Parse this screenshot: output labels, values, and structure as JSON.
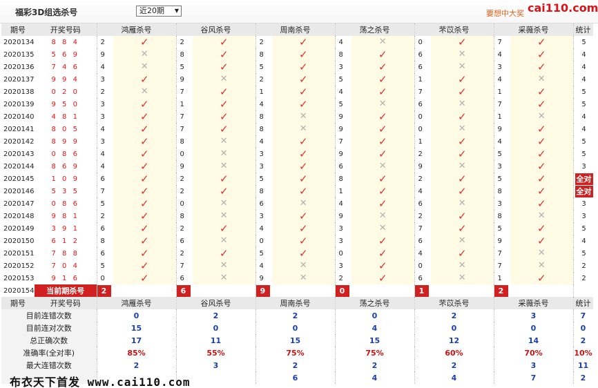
{
  "header": {
    "title": "福彩3D组选杀号",
    "period_select": "近20期",
    "ad_text": "要想中大奖",
    "logo": "cai110.com"
  },
  "columns": {
    "period": "期号",
    "draw": "开奖号码",
    "experts": [
      "鸿雁杀号",
      "谷风杀号",
      "周南杀号",
      "荡之杀号",
      "芣苡杀号",
      "采薇杀号"
    ],
    "stats": "统计"
  },
  "rows": [
    {
      "period": "2020134",
      "draw": "8 8 4",
      "kills": [
        [
          "2",
          "ok"
        ],
        [
          "2",
          "ok"
        ],
        [
          "2",
          "ok"
        ],
        [
          "4",
          "no"
        ],
        [
          "0",
          "ok"
        ],
        [
          "7",
          "ok"
        ]
      ],
      "count": "5"
    },
    {
      "period": "2020135",
      "draw": "5 6 9",
      "kills": [
        [
          "9",
          "no"
        ],
        [
          "8",
          "ok"
        ],
        [
          "8",
          "ok"
        ],
        [
          "8",
          "ok"
        ],
        [
          "6",
          "no"
        ],
        [
          "4",
          "ok"
        ]
      ],
      "count": "4"
    },
    {
      "period": "2020136",
      "draw": "7 4 6",
      "kills": [
        [
          "4",
          "no"
        ],
        [
          "5",
          "ok"
        ],
        [
          "5",
          "ok"
        ],
        [
          "3",
          "ok"
        ],
        [
          "6",
          "no"
        ],
        [
          "3",
          "ok"
        ]
      ],
      "count": "4"
    },
    {
      "period": "2020137",
      "draw": "9 9 4",
      "kills": [
        [
          "3",
          "ok"
        ],
        [
          "9",
          "no"
        ],
        [
          "2",
          "ok"
        ],
        [
          "5",
          "ok"
        ],
        [
          "1",
          "ok"
        ],
        [
          "4",
          "no"
        ]
      ],
      "count": "4"
    },
    {
      "period": "2020138",
      "draw": "0 2 0",
      "kills": [
        [
          "2",
          "no"
        ],
        [
          "7",
          "ok"
        ],
        [
          "1",
          "ok"
        ],
        [
          "4",
          "ok"
        ],
        [
          "7",
          "ok"
        ],
        [
          "1",
          "ok"
        ]
      ],
      "count": "5"
    },
    {
      "period": "2020139",
      "draw": "9 5 0",
      "kills": [
        [
          "3",
          "ok"
        ],
        [
          "1",
          "ok"
        ],
        [
          "4",
          "ok"
        ],
        [
          "5",
          "no"
        ],
        [
          "6",
          "no"
        ],
        [
          "7",
          "ok"
        ]
      ],
      "count": "5"
    },
    {
      "period": "2020140",
      "draw": "4 8 1",
      "kills": [
        [
          "3",
          "ok"
        ],
        [
          "7",
          "ok"
        ],
        [
          "8",
          "no"
        ],
        [
          "9",
          "ok"
        ],
        [
          "0",
          "ok"
        ],
        [
          "1",
          "no"
        ]
      ],
      "count": "4"
    },
    {
      "period": "2020141",
      "draw": "8 0 5",
      "kills": [
        [
          "4",
          "ok"
        ],
        [
          "7",
          "ok"
        ],
        [
          "8",
          "no"
        ],
        [
          "9",
          "ok"
        ],
        [
          "0",
          "no"
        ],
        [
          "9",
          "ok"
        ]
      ],
      "count": "4"
    },
    {
      "period": "2020142",
      "draw": "8 9 9",
      "kills": [
        [
          "3",
          "ok"
        ],
        [
          "8",
          "no"
        ],
        [
          "4",
          "ok"
        ],
        [
          "7",
          "ok"
        ],
        [
          "1",
          "ok"
        ],
        [
          "4",
          "ok"
        ]
      ],
      "count": "5"
    },
    {
      "period": "2020143",
      "draw": "0 8 6",
      "kills": [
        [
          "4",
          "ok"
        ],
        [
          "0",
          "no"
        ],
        [
          "3",
          "ok"
        ],
        [
          "9",
          "ok"
        ],
        [
          "2",
          "ok"
        ],
        [
          "5",
          "ok"
        ]
      ],
      "count": "5"
    },
    {
      "period": "2020144",
      "draw": "8 6 9",
      "kills": [
        [
          "4",
          "ok"
        ],
        [
          "9",
          "no"
        ],
        [
          "3",
          "ok"
        ],
        [
          "6",
          "no"
        ],
        [
          "9",
          "no"
        ],
        [
          "3",
          "ok"
        ]
      ],
      "count": "3"
    },
    {
      "period": "2020145",
      "draw": "1 0 9",
      "kills": [
        [
          "6",
          "ok"
        ],
        [
          "2",
          "ok"
        ],
        [
          "5",
          "ok"
        ],
        [
          "8",
          "ok"
        ],
        [
          "2",
          "ok"
        ],
        [
          "5",
          "ok"
        ]
      ],
      "count": "全对"
    },
    {
      "period": "2020146",
      "draw": "5 3 5",
      "kills": [
        [
          "7",
          "ok"
        ],
        [
          "2",
          "ok"
        ],
        [
          "8",
          "ok"
        ],
        [
          "1",
          "ok"
        ],
        [
          "4",
          "ok"
        ],
        [
          "8",
          "ok"
        ]
      ],
      "count": "全对"
    },
    {
      "period": "2020147",
      "draw": "0 8 6",
      "kills": [
        [
          "5",
          "ok"
        ],
        [
          "0",
          "no"
        ],
        [
          "6",
          "no"
        ],
        [
          "4",
          "ok"
        ],
        [
          "6",
          "no"
        ],
        [
          "3",
          "ok"
        ]
      ],
      "count": "3"
    },
    {
      "period": "2020148",
      "draw": "9 8 1",
      "kills": [
        [
          "2",
          "ok"
        ],
        [
          "8",
          "no"
        ],
        [
          "3",
          "ok"
        ],
        [
          "9",
          "no"
        ],
        [
          "2",
          "ok"
        ],
        [
          "8",
          "no"
        ]
      ],
      "count": "3"
    },
    {
      "period": "2020149",
      "draw": "3 9 1",
      "kills": [
        [
          "6",
          "ok"
        ],
        [
          "2",
          "ok"
        ],
        [
          "4",
          "ok"
        ],
        [
          "3",
          "no"
        ],
        [
          "7",
          "ok"
        ],
        [
          "5",
          "ok"
        ]
      ],
      "count": "5"
    },
    {
      "period": "2020150",
      "draw": "6 1 2",
      "kills": [
        [
          "8",
          "ok"
        ],
        [
          "6",
          "no"
        ],
        [
          "0",
          "ok"
        ],
        [
          "3",
          "ok"
        ],
        [
          "6",
          "no"
        ],
        [
          "9",
          "ok"
        ]
      ],
      "count": "4"
    },
    {
      "period": "2020151",
      "draw": "7 8 8",
      "kills": [
        [
          "6",
          "ok"
        ],
        [
          "2",
          "ok"
        ],
        [
          "5",
          "ok"
        ],
        [
          "0",
          "ok"
        ],
        [
          "4",
          "ok"
        ],
        [
          "7",
          "no"
        ]
      ],
      "count": "5"
    },
    {
      "period": "2020152",
      "draw": "7 0 4",
      "kills": [
        [
          "5",
          "ok"
        ],
        [
          "7",
          "no"
        ],
        [
          "4",
          "no"
        ],
        [
          "3",
          "ok"
        ],
        [
          "0",
          "no"
        ],
        [
          "7",
          "no"
        ]
      ],
      "count": "2"
    },
    {
      "period": "2020153",
      "draw": "9 1 6",
      "kills": [
        [
          "0",
          "ok"
        ],
        [
          "6",
          "no"
        ],
        [
          "9",
          "no"
        ],
        [
          "2",
          "ok"
        ],
        [
          "6",
          "no"
        ],
        [
          "1",
          "ok"
        ]
      ],
      "count": "2"
    }
  ],
  "current": {
    "period": "2020154",
    "label": "当前期杀号",
    "kills": [
      "2",
      "6",
      "9",
      "0",
      "1",
      "2"
    ]
  },
  "stats": [
    {
      "label": "目前连错次数",
      "values": [
        "0",
        "2",
        "2",
        "0",
        "2",
        "3"
      ],
      "total": "7",
      "kind": "num"
    },
    {
      "label": "目前连对次数",
      "values": [
        "15",
        "0",
        "0",
        "4",
        "0",
        "0"
      ],
      "total": "0",
      "kind": "num"
    },
    {
      "label": "总正确次数",
      "values": [
        "17",
        "11",
        "15",
        "15",
        "12",
        "14"
      ],
      "total": "2",
      "kind": "num"
    },
    {
      "label": "准确率(全对率)",
      "values": [
        "85%",
        "55%",
        "75%",
        "75%",
        "60%",
        "70%"
      ],
      "total": "10%",
      "kind": "rate"
    },
    {
      "label": "最大连错次数",
      "values": [
        "2",
        "3",
        "2",
        "2",
        "2",
        "3"
      ],
      "total": "11",
      "kind": "num"
    },
    {
      "label": "",
      "values": [
        "",
        "",
        "6",
        "4",
        "4",
        "7"
      ],
      "total": "2",
      "kind": "num"
    }
  ],
  "footer": "布衣天下首发 www.cai110.com",
  "colors": {
    "accent": "#d02020",
    "stat_blue": "#1a3fb4",
    "mark_bg": "#fffbe5"
  },
  "icons": {
    "ok": "check-icon",
    "no": "cross-icon"
  }
}
